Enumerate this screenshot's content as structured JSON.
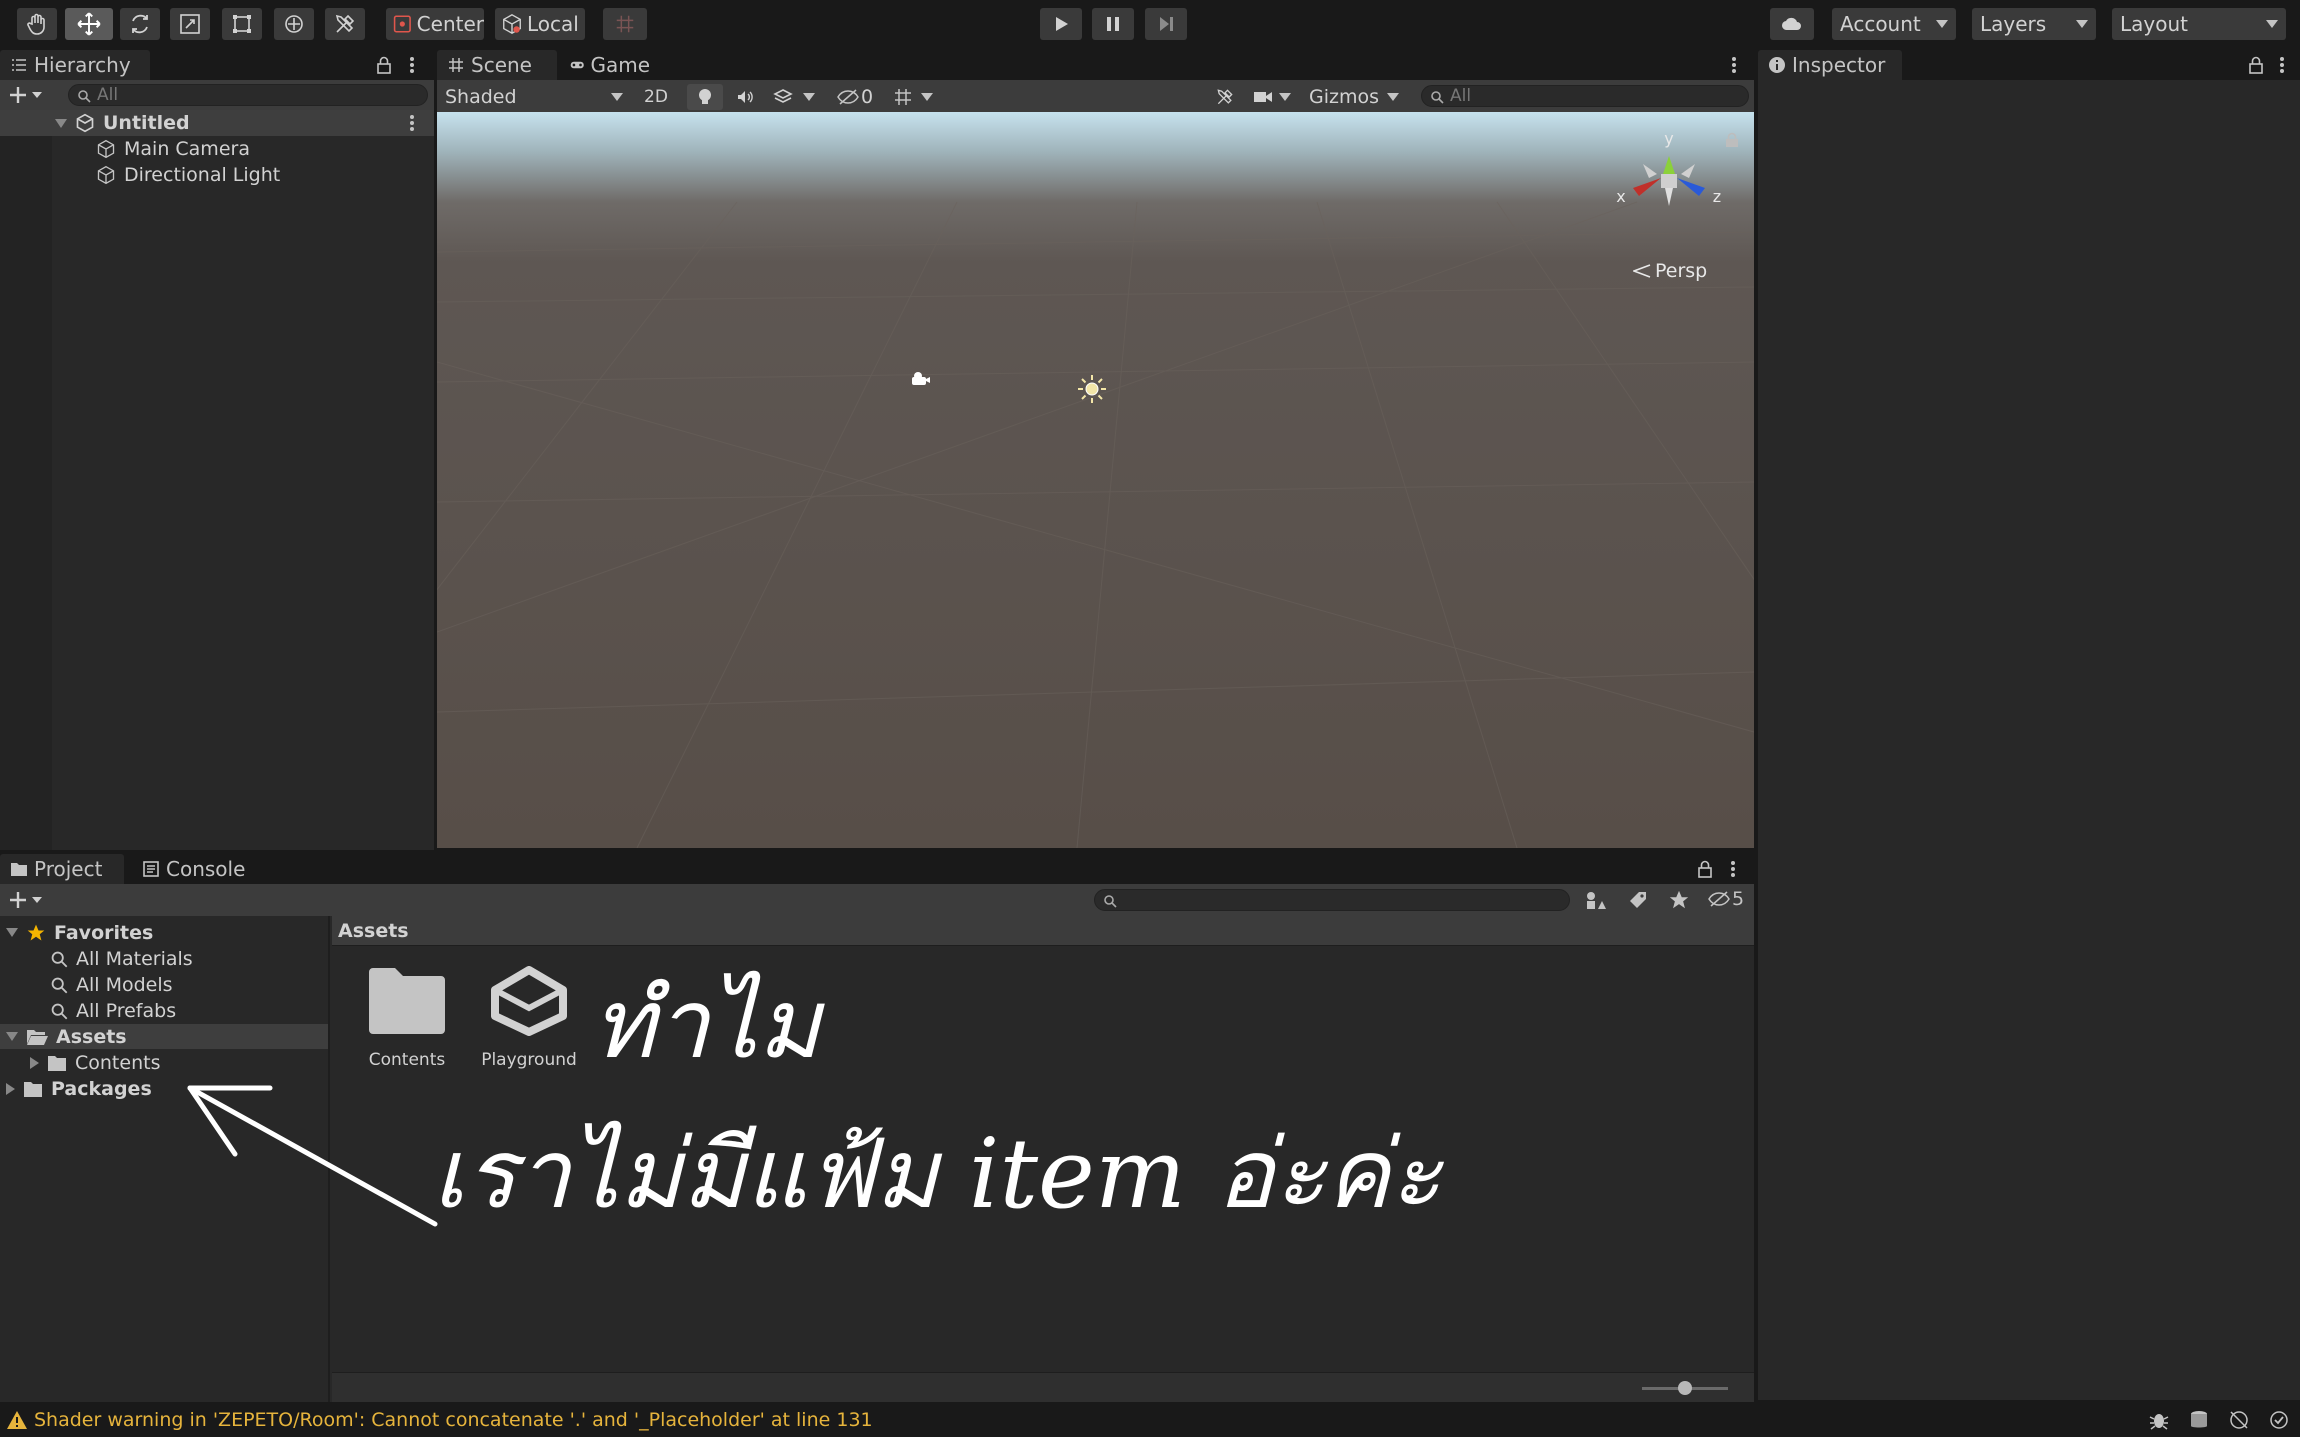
{
  "toolbar": {
    "pivot_label": "Center",
    "space_label": "Local",
    "account_label": "Account",
    "layers_label": "Layers",
    "layout_label": "Layout"
  },
  "hierarchy": {
    "tab_label": "Hierarchy",
    "search_placeholder": "All",
    "scene_name": "Untitled",
    "items": [
      "Main Camera",
      "Directional Light"
    ]
  },
  "scene": {
    "tabs": [
      "Scene",
      "Game"
    ],
    "shading_mode": "Shaded",
    "mode_2d": "2D",
    "hidden_count": "0",
    "gizmos_label": "Gizmos",
    "search_placeholder": "All",
    "axis_labels": {
      "x": "x",
      "y": "y",
      "z": "z"
    },
    "projection_label": "Persp"
  },
  "inspector": {
    "tab_label": "Inspector"
  },
  "project": {
    "tabs": [
      "Project",
      "Console"
    ],
    "hidden_count": "5",
    "favorites_label": "Favorites",
    "favorites": [
      "All Materials",
      "All Models",
      "All Prefabs"
    ],
    "assets_label": "Assets",
    "assets_children": [
      "Contents"
    ],
    "packages_label": "Packages",
    "breadcrumb": "Assets",
    "assets": [
      {
        "name": "Contents",
        "icon": "folder-icon"
      },
      {
        "name": "Playground",
        "icon": "unity-scene-icon"
      }
    ],
    "zoom_fraction": 0.5
  },
  "annotation": {
    "line1": "ทำไม",
    "line2": "เราไม่มีแฟ้ม item อ่ะค่ะ"
  },
  "status": {
    "message": "Shader warning in 'ZEPETO/Room': Cannot concatenate '.' and '_Placeholder' at line 131"
  },
  "colors": {
    "background": "#191919",
    "panel": "#282828",
    "warning": "#e6b43c",
    "favorites_star": "#f4b400"
  }
}
